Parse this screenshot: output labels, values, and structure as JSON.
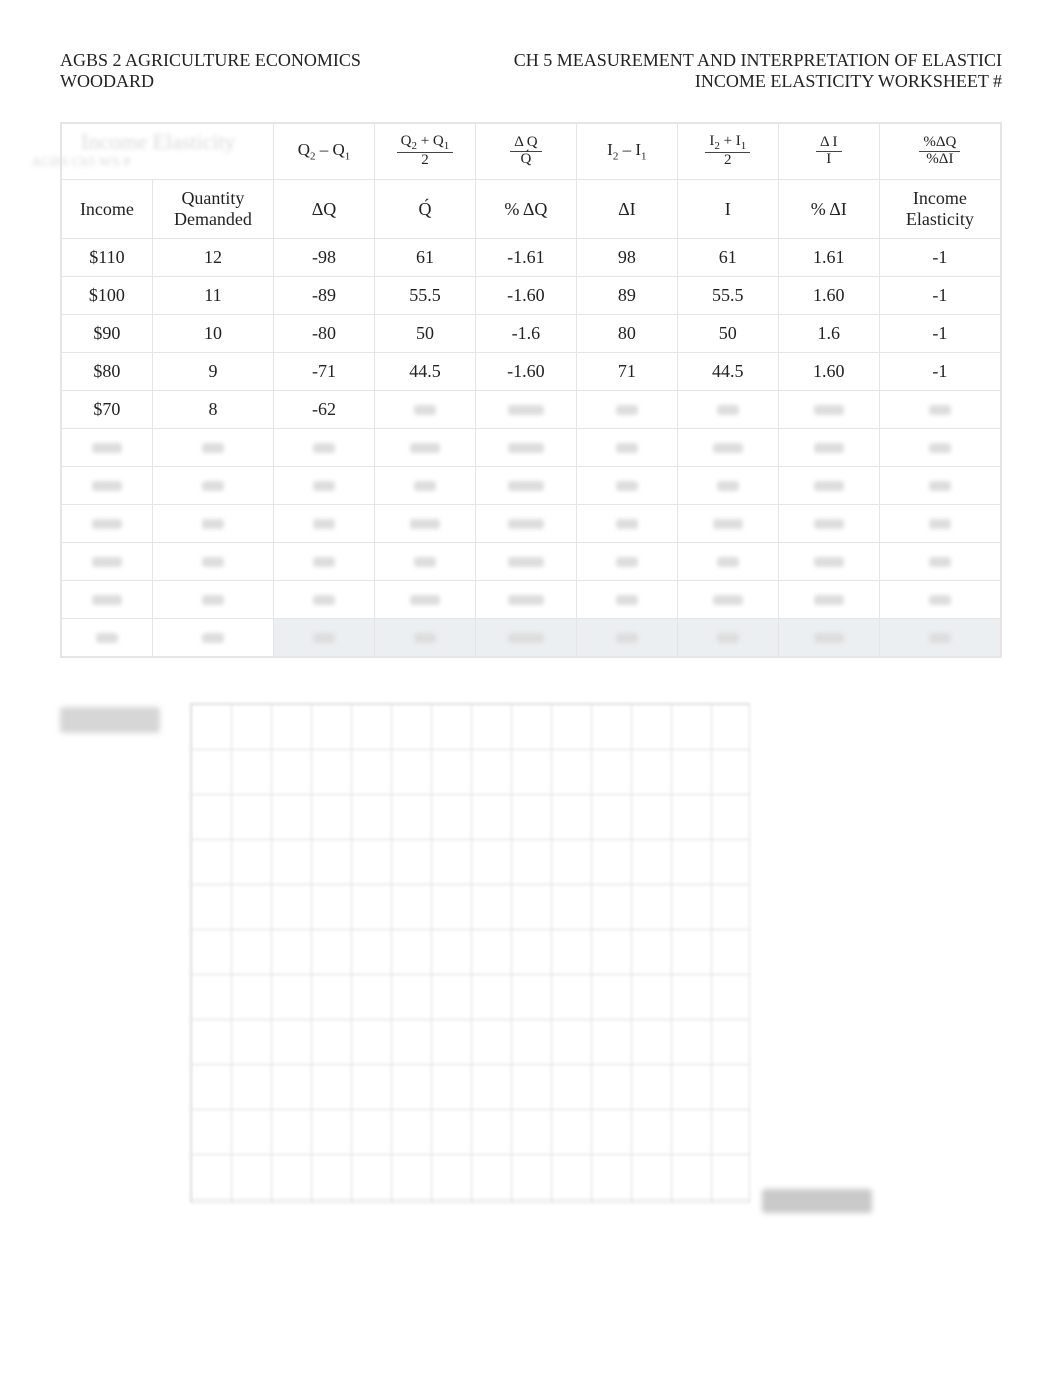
{
  "header": {
    "left_line1": "AGBS 2 AGRICULTURE ECONOMICS",
    "left_line2": "WOODARD",
    "right_line1": "CH 5 MEASUREMENT AND INTERPRETATION OF ELASTICI",
    "right_line2": "INCOME ELASTICITY WORKSHEET #"
  },
  "formula_headers": {
    "c1": "",
    "c2": "",
    "c3": "Q₂ – Q₁",
    "c4": {
      "num": "Q₂ + Q₁",
      "den": "2"
    },
    "c5": {
      "num": "Δ Q",
      "den": "Q́"
    },
    "c6": "I₂ – I₁",
    "c7": {
      "num": "I₂ + I₁",
      "den": "2"
    },
    "c8": {
      "num": "Δ I",
      "den": "I"
    },
    "c9": {
      "num": "%ΔQ",
      "den": "%ΔI"
    }
  },
  "label_row": {
    "c1": "Income",
    "c2": "Quantity Demanded",
    "c3": "ΔQ",
    "c4": "Q́",
    "c5": "% ΔQ",
    "c6": "ΔI",
    "c7": "I",
    "c8": "% ΔI",
    "c9": "Income Elasticity"
  },
  "rows": [
    {
      "income": "$110",
      "qd": "12",
      "dq": "-98",
      "qbar": "61",
      "pdq": "-1.61",
      "di": "98",
      "ibar": "61",
      "pdi": "1.61",
      "elas": "-1"
    },
    {
      "income": "$100",
      "qd": "11",
      "dq": "-89",
      "qbar": "55.5",
      "pdq": "-1.60",
      "di": "89",
      "ibar": "55.5",
      "pdi": "1.60",
      "elas": "-1"
    },
    {
      "income": "$90",
      "qd": "10",
      "dq": "-80",
      "qbar": "50",
      "pdq": "-1.6",
      "di": "80",
      "ibar": "50",
      "pdi": "1.6",
      "elas": "-1"
    },
    {
      "income": "$80",
      "qd": "9",
      "dq": "-71",
      "qbar": "44.5",
      "pdq": "-1.60",
      "di": "71",
      "ibar": "44.5",
      "pdi": "1.60",
      "elas": "-1"
    },
    {
      "income": "$70",
      "qd": "8",
      "dq": "-62",
      "qbar": "",
      "pdq": "",
      "di": "",
      "ibar": "",
      "pdi": "",
      "elas": ""
    }
  ],
  "axis_labels": {
    "y": "Income",
    "x": "Quantity"
  }
}
